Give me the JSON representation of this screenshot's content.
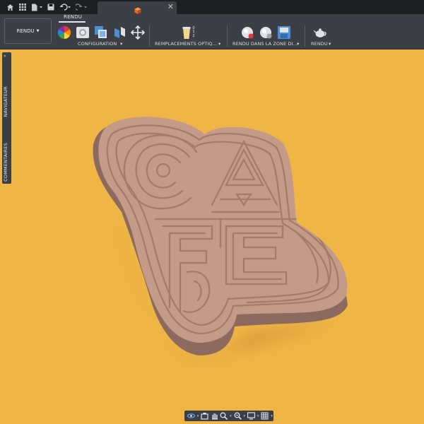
{
  "titlebar": {
    "icons": [
      "home-icon",
      "grid-icon",
      "file-icon",
      "save-icon",
      "undo-icon",
      "redo-icon"
    ],
    "tab_close": "✕"
  },
  "ribbon": {
    "workspace_tab": "RENDU",
    "workspace_button": "RENDU",
    "groups": [
      {
        "label": "CONFIGURATION",
        "tools": [
          "color-wheel-icon",
          "scene-settings-icon",
          "texture-map-icon",
          "decal-icon",
          "move-icon"
        ]
      },
      {
        "label": "REMPLACEMENTS OPTIQ...",
        "tools": [
          "appearance-override-icon"
        ],
        "tool_text": [
          "0",
          "1",
          "2"
        ]
      },
      {
        "label": "RENDU DANS LA ZONE DI...",
        "tools": [
          "in-canvas-render-icon",
          "in-canvas-render-settings-icon",
          "capture-image-icon"
        ]
      },
      {
        "label": "RENDU",
        "tools": [
          "teapot-render-icon"
        ]
      }
    ]
  },
  "sidepanel": {
    "navigator": "NAVIGATEUR",
    "comments": "COMMENTAIRES"
  },
  "navbar": {
    "tools": [
      "orbit-icon",
      "look-at-icon",
      "pan-icon",
      "zoom-icon",
      "fit-icon",
      "display-settings-icon",
      "grid-settings-icon"
    ]
  },
  "colors": {
    "background": "#efb646",
    "model": "#c49a88",
    "ui_dark": "#3c4046",
    "titlebar": "#1e1f21"
  }
}
